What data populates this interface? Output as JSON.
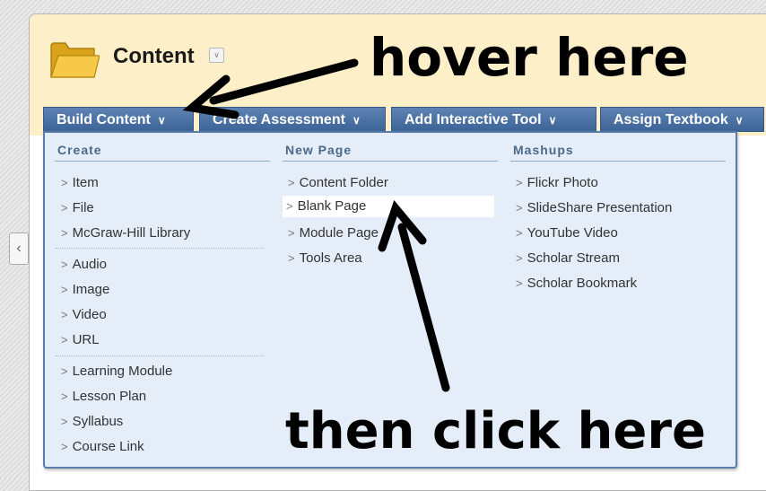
{
  "page": {
    "title": "Content"
  },
  "toolbar": [
    {
      "label": "Build Content"
    },
    {
      "label": "Create Assessment"
    },
    {
      "label": "Add Interactive Tool"
    },
    {
      "label": "Assign Textbook"
    }
  ],
  "dropdown": {
    "create": {
      "header": "Create",
      "groups": [
        [
          "Item",
          "File",
          "McGraw-Hill Library"
        ],
        [
          "Audio",
          "Image",
          "Video",
          "URL"
        ],
        [
          "Learning Module",
          "Lesson Plan",
          "Syllabus",
          "Course Link"
        ]
      ]
    },
    "new_page": {
      "header": "New Page",
      "items": [
        "Content Folder",
        "Blank Page",
        "Module Page",
        "Tools Area"
      ],
      "highlighted": "Blank Page"
    },
    "mashups": {
      "header": "Mashups",
      "items": [
        "Flickr Photo",
        "SlideShare Presentation",
        "YouTube Video",
        "Scholar Stream",
        "Scholar Bookmark"
      ]
    }
  },
  "annotations": {
    "hover": "hover here",
    "click": "then click here"
  },
  "icons": {
    "folder": "folder-icon",
    "title_menu": "chevron-down-icon",
    "sidebar_toggle": "chevron-left-icon",
    "item_caret": "chevron-right-icon"
  },
  "colors": {
    "header_bg": "#fdf0c8",
    "toolbar_button": "#4a6fa3",
    "menu_bg": "#e4edf8",
    "menu_border": "#5a7ea9"
  }
}
